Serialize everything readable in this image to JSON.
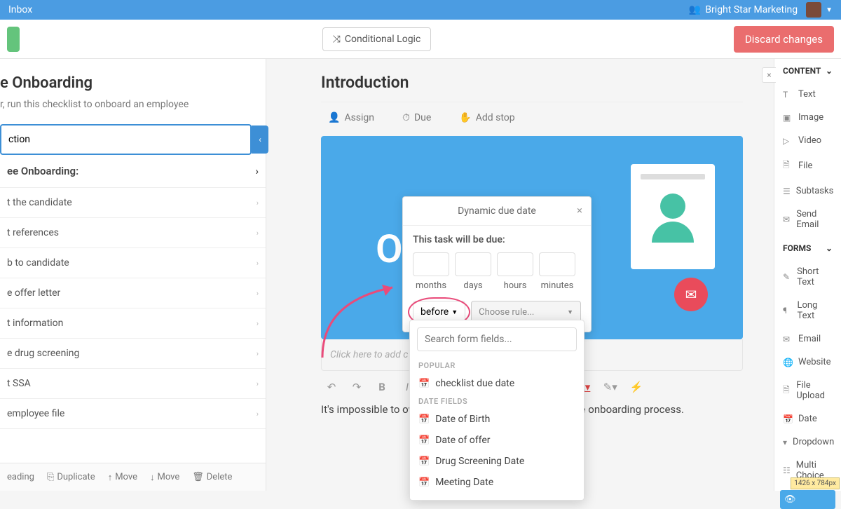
{
  "topbar": {
    "inbox": "Inbox",
    "org": "Bright Star Marketing"
  },
  "toolbar": {
    "conditional": "Conditional Logic",
    "discard": "Discard changes"
  },
  "left": {
    "title": "e Onboarding",
    "desc": "r, run this checklist to onboard an employee",
    "active": "ction",
    "header": "ee Onboarding:",
    "steps": [
      "t the candidate",
      "t references",
      "b to candidate",
      "e offer letter",
      "t information",
      "e drug screening",
      "t SSA",
      "employee file"
    ],
    "bottom": [
      "eading",
      "Duplicate",
      "Move",
      "Move",
      "Delete"
    ]
  },
  "main": {
    "heading": "Introduction",
    "actions": {
      "assign": "Assign",
      "due": "Due",
      "addstop": "Add stop"
    },
    "hero_text": "O",
    "caption": "Click here to add c",
    "body": "It's impossible to overstate the value of a good employee onboarding process."
  },
  "popover": {
    "title": "Dynamic due date",
    "label": "This task will be due:",
    "units": [
      "months",
      "days",
      "hours",
      "minutes"
    ],
    "before": "before",
    "choose": "Choose rule..."
  },
  "dropdown": {
    "placeholder": "Search form fields...",
    "popular_hdr": "POPULAR",
    "popular": [
      "checklist due date"
    ],
    "date_hdr": "DATE FIELDS",
    "dates": [
      "Date of Birth",
      "Date of offer",
      "Drug Screening Date",
      "Meeting Date"
    ]
  },
  "right": {
    "content_hdr": "CONTENT",
    "content": [
      "Text",
      "Image",
      "Video",
      "File",
      "Subtasks",
      "Send Email"
    ],
    "forms_hdr": "FORMS",
    "forms": [
      "Short Text",
      "Long Text",
      "Email",
      "Website",
      "File Upload",
      "Date",
      "Dropdown",
      "Multi Choice"
    ],
    "dims": "1426 x 784px"
  }
}
